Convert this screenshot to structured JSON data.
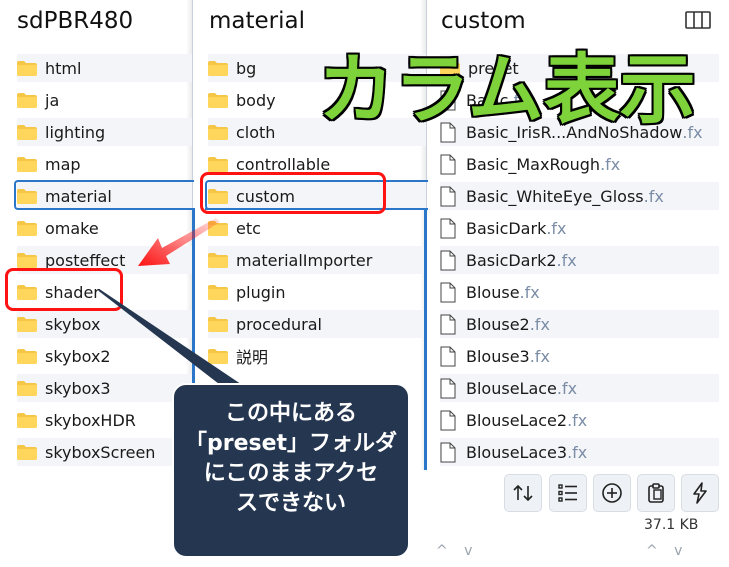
{
  "columns": {
    "col1": {
      "title": "sdPBR480",
      "items": [
        "html",
        "ja",
        "lighting",
        "map",
        "material",
        "omake",
        "posteffect",
        "shader",
        "skybox",
        "skybox2",
        "skybox3",
        "skyboxHDR",
        "skyboxScreen"
      ]
    },
    "col2": {
      "title": "material",
      "items": [
        "bg",
        "body",
        "cloth",
        "controllable",
        "custom",
        "etc",
        "materialImporter",
        "plugin",
        "procedural",
        "説明"
      ]
    },
    "col3": {
      "title": "custom",
      "folder": "preset",
      "files": [
        {
          "name": "Basic",
          "ext": ".fx"
        },
        {
          "name": "Basic_IrisR...AndNoShadow",
          "ext": ".fx"
        },
        {
          "name": "Basic_MaxRough",
          "ext": ".fx"
        },
        {
          "name": "Basic_WhiteEye_Gloss",
          "ext": ".fx"
        },
        {
          "name": "BasicDark",
          "ext": ".fx"
        },
        {
          "name": "BasicDark2",
          "ext": ".fx"
        },
        {
          "name": "Blouse",
          "ext": ".fx"
        },
        {
          "name": "Blouse2",
          "ext": ".fx"
        },
        {
          "name": "Blouse3",
          "ext": ".fx"
        },
        {
          "name": "BlouseLace",
          "ext": ".fx"
        },
        {
          "name": "BlouseLace2",
          "ext": ".fx"
        },
        {
          "name": "BlouseLace3",
          "ext": ".fx"
        }
      ]
    }
  },
  "annotations": {
    "big_label": "カラム表示",
    "callout_lines": [
      "この中にある",
      "「preset」フォルダ",
      "にこのままアクセ",
      "スできない"
    ]
  },
  "status": {
    "size": "37.1 KB"
  },
  "toolbar": {
    "icons": [
      "sort-icon",
      "list-icon",
      "add-icon",
      "clipboard-icon",
      "flash-icon"
    ]
  },
  "icons": {
    "view": "columns-view-icon",
    "folder": "folder-icon",
    "file": "file-icon"
  },
  "colors": {
    "selection": "#2a76c9",
    "highlight": "#ff1212",
    "label_green": "#7ed33a",
    "callout_bg": "#253650",
    "folder_yellow": "#f6c646"
  }
}
